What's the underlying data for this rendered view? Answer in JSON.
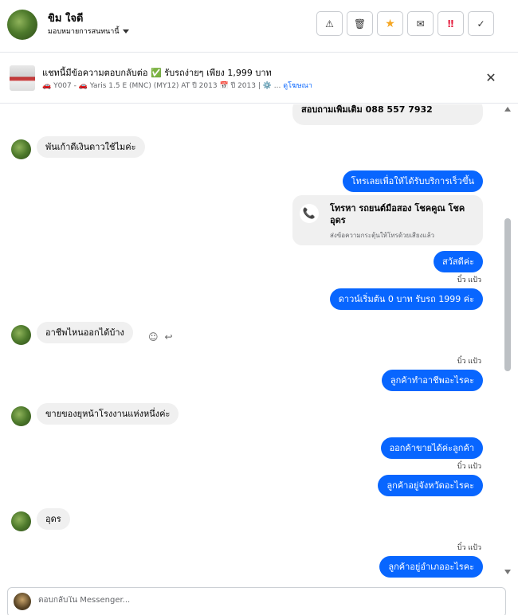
{
  "header": {
    "name": "ขิม ใจดี",
    "assign_label": "มอบหมายการสนทนานี้",
    "actions": [
      {
        "icon": "warning-icon",
        "glyph": "⚠"
      },
      {
        "icon": "trash-icon",
        "glyph": "🗑"
      },
      {
        "icon": "star-icon",
        "glyph": "★",
        "color": "#f5a623"
      },
      {
        "icon": "envelope-icon",
        "glyph": "✉"
      },
      {
        "icon": "exclamation-icon",
        "glyph": "‼",
        "color": "#e41e3f"
      },
      {
        "icon": "check-icon",
        "glyph": "✓"
      }
    ]
  },
  "banner": {
    "title": "แชทนี้มีข้อความตอบกลับต่อ ✅ รับรถง่ายๆ เพียง 1,999 บาท",
    "subtitle": "🚗 Y007 - 🚗 Yaris 1.5 E (MNC) (MY12) AT ปี 2013 📅 ปี 2013 | ⚙️ ...",
    "link": "ดูโฆษณา"
  },
  "chat": {
    "partial_top": "สอบถามเพิ่มเติม 088 557 7932",
    "messages": [
      {
        "dir": "in",
        "text": "พันเก้าดีเงินดาวใช้ไมค่ะ"
      },
      {
        "dir": "out",
        "text": "โทรเลยเพื่อให้ได้รับบริการเร็วขึ้น"
      },
      {
        "dir": "card",
        "title": "โทรหา รถยนต์มือสอง โชคคูณ โชค อุดร",
        "sub": "ส่งข้อความกระตุ้นให้โทรด้วยเสียงแล้ว"
      },
      {
        "dir": "out",
        "text": "สวัสดีค่ะ"
      },
      {
        "dir": "read",
        "text": "บิ๋ว แป้ว"
      },
      {
        "dir": "out",
        "text": "ดาวน์เริ่มต้น 0 บาท รับรถ 1999 ค่ะ"
      },
      {
        "dir": "in",
        "text": "อาชีพไหนออกได้บ้าง"
      },
      {
        "dir": "read",
        "text": "บิ๋ว แป้ว"
      },
      {
        "dir": "out",
        "text": "ลูกค้าทำอาชีพอะไรคะ"
      },
      {
        "dir": "in",
        "text": "ขายของยุหน้าโรงงานแห่งหนึ่งค่ะ"
      },
      {
        "dir": "out",
        "text": "ออกค้าขายได้ค่ะลูกค้า"
      },
      {
        "dir": "read",
        "text": "บิ๋ว แป้ว"
      },
      {
        "dir": "out",
        "text": "ลูกค้าอยู่จังหวัดอะไรคะ"
      },
      {
        "dir": "in",
        "text": "อุดร"
      },
      {
        "dir": "read",
        "text": "บิ๋ว แป้ว"
      },
      {
        "dir": "out",
        "text": "ลูกค้าอยู่อำเภออะไรคะ"
      }
    ]
  },
  "composer": {
    "placeholder": "ตอบกลับใน Messenger..."
  },
  "colors": {
    "outgoing_bubble": "#0866ff",
    "incoming_bubble": "#f0f0f0",
    "link": "#0866ff"
  }
}
